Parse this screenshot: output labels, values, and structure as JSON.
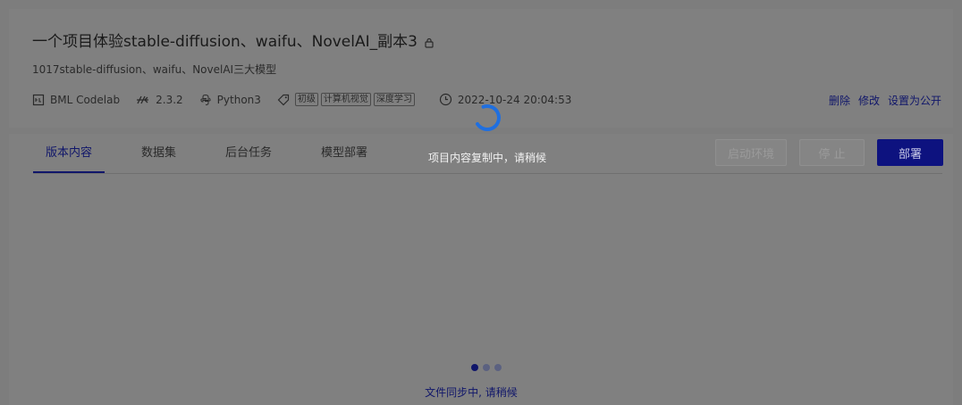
{
  "project": {
    "title": "一个项目体验stable-diffusion、waifu、NovelAI_副本3",
    "subtitle": "1017stable-diffusion、waifu、NovelAI三大模型",
    "meta": {
      "env": "BML Codelab",
      "version": "2.3.2",
      "language": "Python3",
      "tags": [
        "初级",
        "计算机视觉",
        "深度学习"
      ],
      "timestamp": "2022-10-24 20:04:53"
    },
    "actions": {
      "delete": "删除",
      "edit": "修改",
      "make_public": "设置为公开"
    }
  },
  "tabs": [
    {
      "label": "版本内容",
      "active": true
    },
    {
      "label": "数据集",
      "active": false
    },
    {
      "label": "后台任务",
      "active": false
    },
    {
      "label": "模型部署",
      "active": false
    }
  ],
  "buttons": {
    "start": "启动环境",
    "stop": "停 止",
    "deploy": "部署"
  },
  "sync_status": "文件同步中, 请稍候",
  "overlay": {
    "loading_text": "项目内容复制中，请稍候"
  },
  "colors": {
    "accent": "#10166a",
    "spinner": "#1f6fe0"
  }
}
